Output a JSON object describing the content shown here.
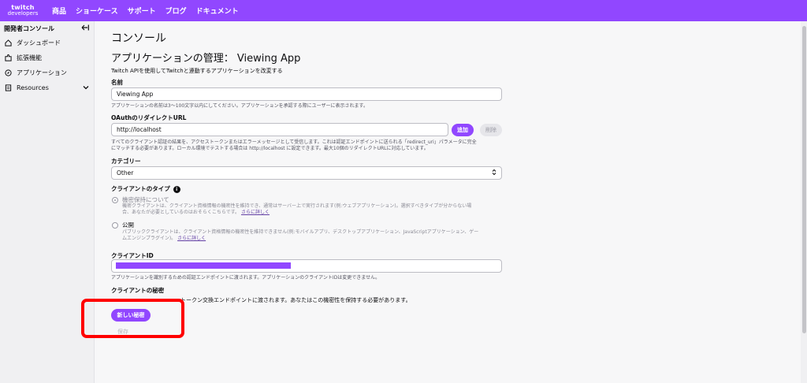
{
  "topnav": {
    "logo_line1": "twitch",
    "logo_line2": "developers",
    "items": [
      "商品",
      "ショーケース",
      "サポート",
      "ブログ",
      "ドキュメント"
    ]
  },
  "sidebar": {
    "heading": "開発者コンソール",
    "collapse_icon": "collapse-left-icon",
    "items": [
      {
        "label": "ダッシュボード",
        "icon": "home-icon"
      },
      {
        "label": "拡張機能",
        "icon": "puzzle-icon"
      },
      {
        "label": "アプリケーション",
        "icon": "compass-icon"
      },
      {
        "label": "Resources",
        "icon": "document-icon"
      }
    ]
  },
  "main": {
    "title": "コンソール",
    "app_title": "アプリケーションの管理： Viewing App",
    "subtitle": "Twitch APIを使用してTwitchと連動するアプリケーションを改変する",
    "name": {
      "label": "名前",
      "value": "Viewing App",
      "help": "アプリケーションの名前は3～100文字以内にしてください。アプリケーションを承認する際にユーザーに表示されます。"
    },
    "oauth": {
      "label": "OAuthのリダイレクトURL",
      "value": "http://localhost",
      "add_button": "追加",
      "remove_button": "削除",
      "help_line1": "すべてのクライアント認証の結果を、アクセストークンまたはエラーメッセージとして受信します。これは認証エンドポイントに送られる「redirect_uri」パラメータに完全",
      "help_line2": "にマッチする必要があります。ローカル環境でテストする場合は http://localhost に設定できます。最大10個のリダイレクトURLに対応しています。"
    },
    "category": {
      "label": "カテゴリー",
      "value": "Other"
    },
    "client_type": {
      "label": "クライアントのタイプ",
      "confidential_label": "機密保持について",
      "confidential_desc1": "機密クライアントは、クライアント資格情報の機密性を維持でき、通常はサーバー上で実行されます(例:ウェブアプリケーション)。選択すべきタイプが分からない場",
      "confidential_desc2": "合、あなたが必要としているのはおそらくこちらです。",
      "confidential_more": "さらに詳しく",
      "public_label": "公開",
      "public_desc1": "パブリッククライアントは、クライアント資格情報の機密性を維持できません(例:モバイルアプリ、デスクトップアプリケーション、JavaScriptアプリケーション、ゲー",
      "public_desc2": "ムエンジンプラグイン)。",
      "public_more": "さらに詳しく"
    },
    "client_id": {
      "label": "クライアントID",
      "help": "アプリケーションを識別するための認証エンドポイントに渡されます。アプリケーションのクライアントIDは変更できません。"
    },
    "client_secret": {
      "label": "クライアントの秘密",
      "help": "トークン交換エンドポイントに渡されます。あなたはこの機密性を保持する必要があります。",
      "new_secret_button": "新しい秘密"
    },
    "save_button": "保存"
  },
  "colors": {
    "brand": "#9147ff",
    "highlight": "#ff0000"
  }
}
